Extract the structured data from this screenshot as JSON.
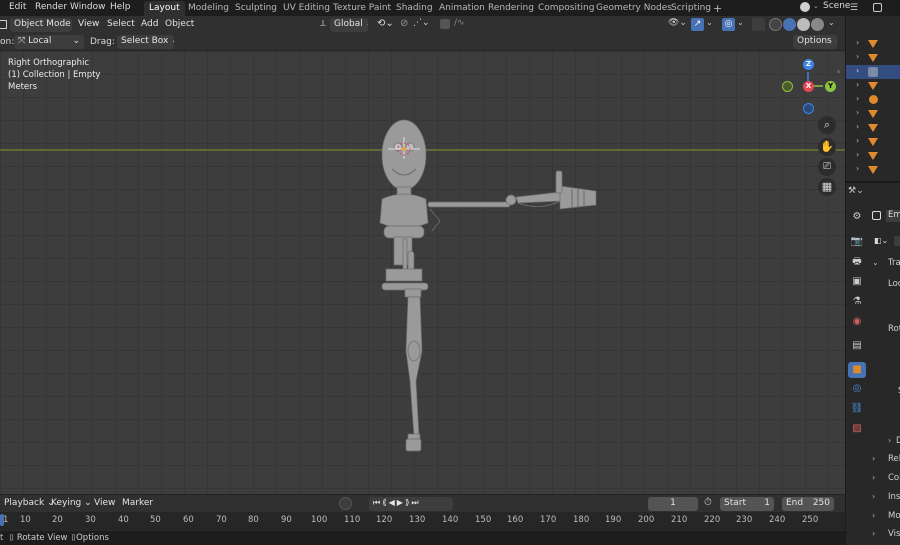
{
  "menubar": {
    "items": [
      "Edit",
      "Render",
      "Window",
      "Help"
    ],
    "workspaces": [
      "Layout",
      "Modeling",
      "Sculpting",
      "UV Editing",
      "Texture Paint",
      "Shading",
      "Animation",
      "Rendering",
      "Compositing",
      "Geometry Nodes",
      "Scripting"
    ],
    "add_tab": "+",
    "scene": "Scene"
  },
  "header": {
    "mode": "Object Mode",
    "menus": [
      "View",
      "Select",
      "Add",
      "Object"
    ],
    "transform_orientation": "Global"
  },
  "tool_settings": {
    "orientation_label": "on:",
    "orientation_value": "Local",
    "drag_label": "Drag:",
    "drag_value": "Select Box",
    "options": "Options"
  },
  "viewport": {
    "view_name": "Right Orthographic",
    "collection": "(1) Collection | Empty",
    "units": "Meters",
    "gizmo": {
      "z": "Z",
      "y": "Y",
      "x": "X"
    }
  },
  "timeline": {
    "menus": [
      "Playback",
      "Keying",
      "View",
      "Marker"
    ],
    "current_frame": "1",
    "start_label": "Start",
    "start": "1",
    "end_label": "End",
    "end": "250"
  },
  "ruler": {
    "ticks": [
      "1",
      "10",
      "20",
      "30",
      "40",
      "50",
      "60",
      "70",
      "80",
      "90",
      "100",
      "110",
      "120",
      "130",
      "140",
      "150",
      "160",
      "170",
      "180",
      "190",
      "200",
      "210",
      "220",
      "230",
      "240",
      "250"
    ]
  },
  "status": {
    "rotate": "Rotate View",
    "options": "Options"
  },
  "properties": {
    "object_name": "Em",
    "labels": {
      "transform": "Tran",
      "location": "Loc",
      "rotation": "Rot",
      "scale": "S",
      "delta": "D",
      "relations": "Rela",
      "collections": "Colle",
      "instancing": "Inst",
      "motion": "Mot",
      "visibility": "Visi"
    }
  },
  "colors": {
    "accent": "#4772b3",
    "x_axis": "#e64757",
    "y_axis": "#8cc43f",
    "z_axis": "#3d85e6",
    "orange": "#e08a2c"
  }
}
